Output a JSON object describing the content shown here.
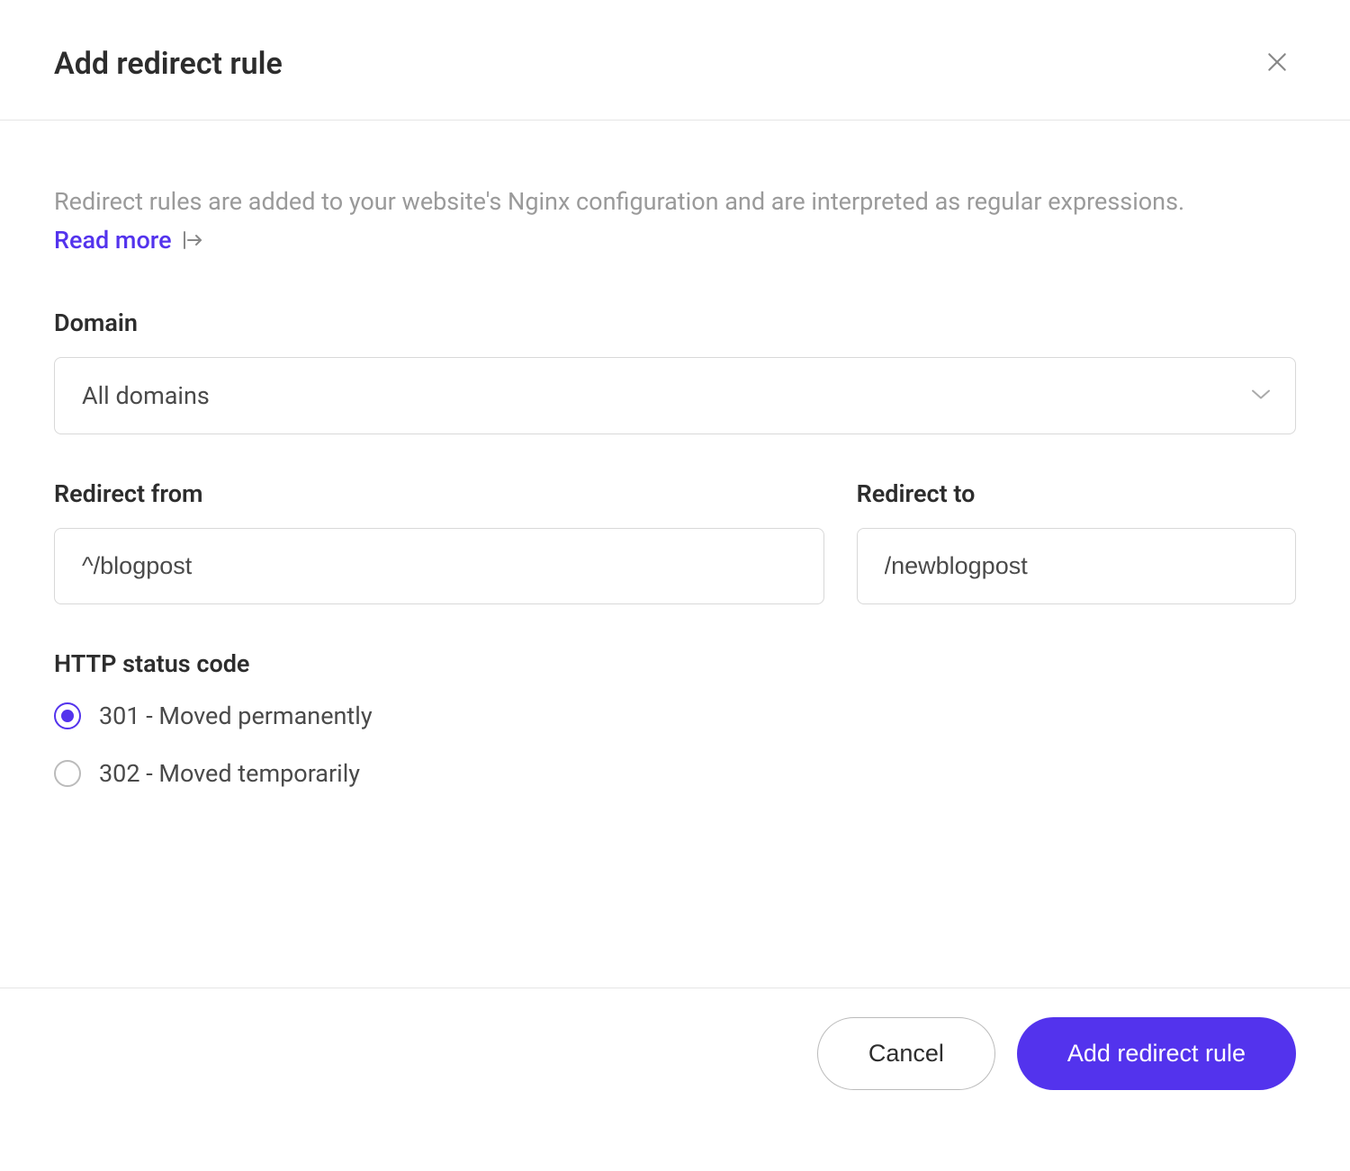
{
  "header": {
    "title": "Add redirect rule"
  },
  "body": {
    "description": "Redirect rules are added to your website's Nginx configuration and are interpreted as regular expressions.",
    "read_more": "Read more"
  },
  "form": {
    "domain": {
      "label": "Domain",
      "value": "All domains"
    },
    "redirect_from": {
      "label": "Redirect from",
      "value": "^/blogpost"
    },
    "redirect_to": {
      "label": "Redirect to",
      "value": "/newblogpost"
    },
    "status_code": {
      "label": "HTTP status code",
      "options": [
        {
          "label": "301 - Moved permanently",
          "selected": true
        },
        {
          "label": "302 - Moved temporarily",
          "selected": false
        }
      ]
    }
  },
  "footer": {
    "cancel": "Cancel",
    "submit": "Add redirect rule"
  }
}
